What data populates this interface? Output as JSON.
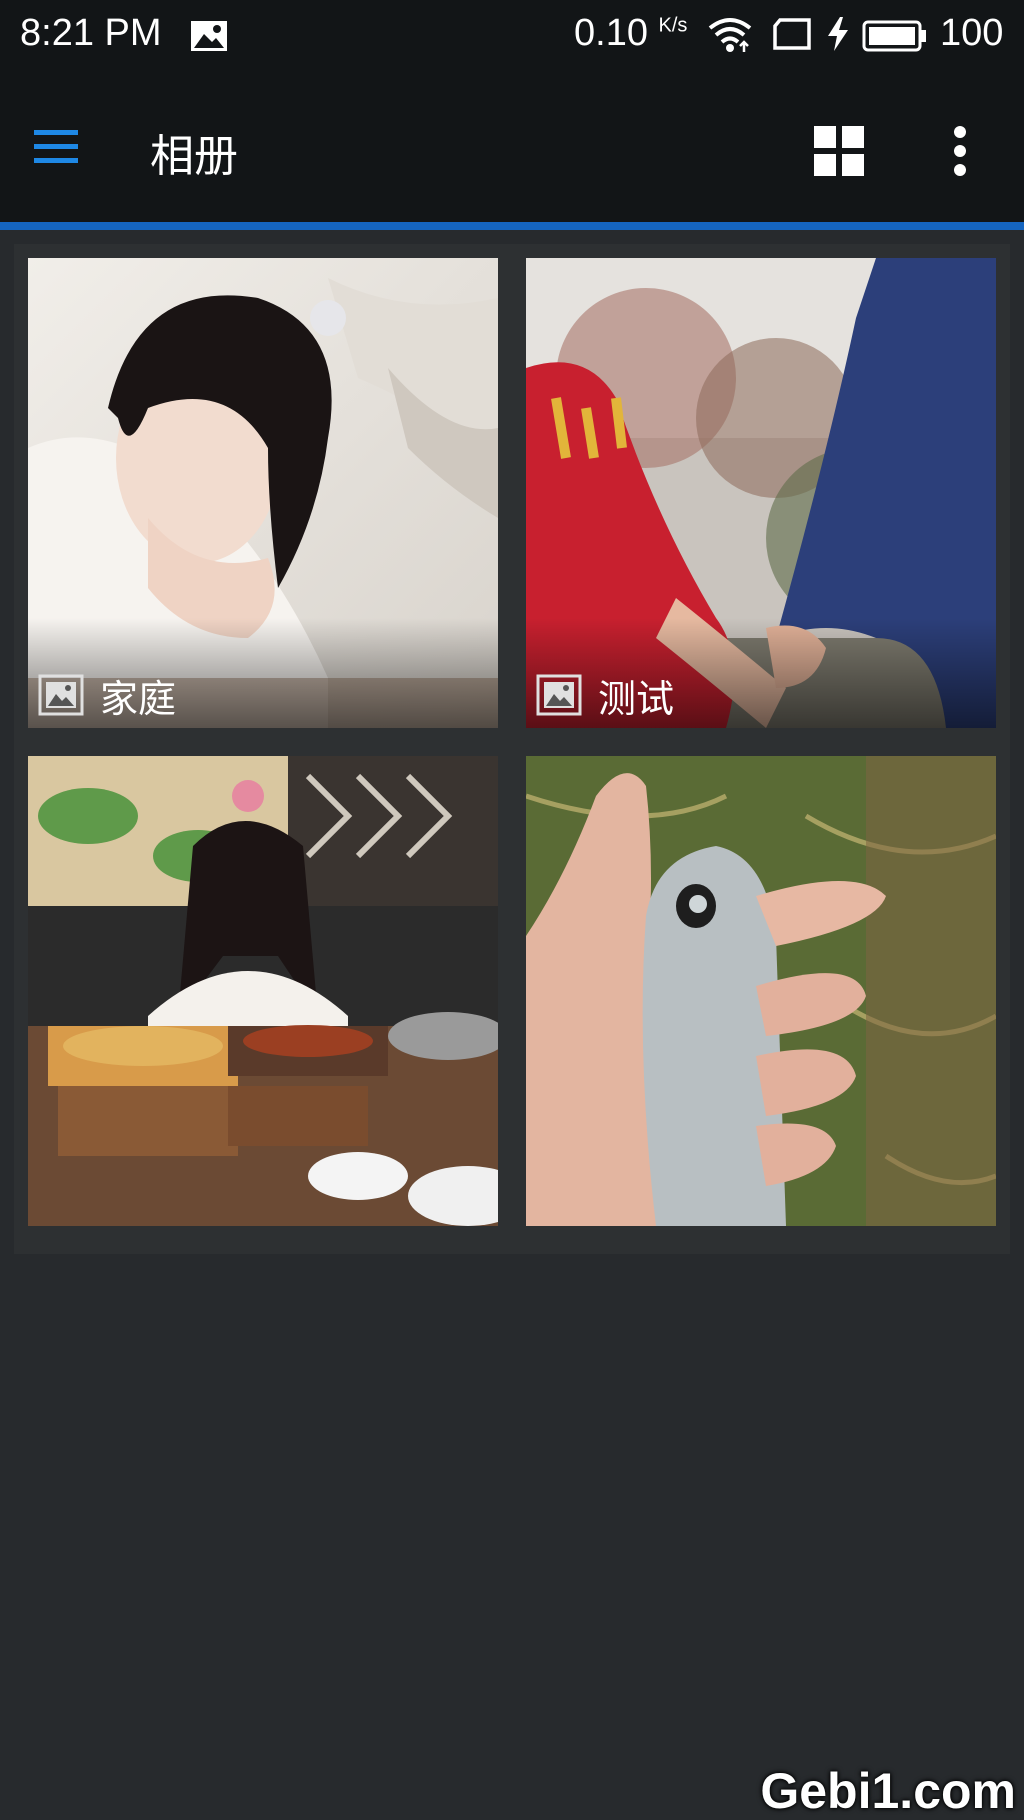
{
  "status_bar": {
    "time": "8:21 PM",
    "network_speed": "0.10",
    "speed_unit": "K/s",
    "battery_level": "100",
    "icons": [
      "gallery-notification-icon",
      "wifi-icon",
      "sim-icon",
      "charging-icon",
      "battery-icon"
    ]
  },
  "app_bar": {
    "title": "相册",
    "accent_color": "#1565c0",
    "icons": [
      "menu-icon",
      "grid-view-icon",
      "more-options-icon"
    ]
  },
  "albums": [
    {
      "name": "家庭",
      "thumbnail": "woman in traditional costume"
    },
    {
      "name": "测试",
      "thumbnail": "couple holding hands"
    },
    {
      "name": "",
      "thumbnail": "girl at dining table with grilled food"
    },
    {
      "name": "",
      "thumbnail": "hand holding fish"
    }
  ],
  "watermark": "Gebi1.com"
}
